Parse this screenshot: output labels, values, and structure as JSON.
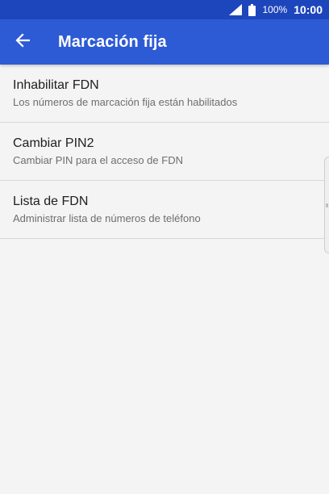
{
  "status_bar": {
    "battery_percent": "100%",
    "time": "10:00",
    "signal_icon": "signal-icon",
    "battery_icon": "battery-icon"
  },
  "app_bar": {
    "back_icon": "arrow-back-icon",
    "title": "Marcación fija"
  },
  "items": [
    {
      "title": "Inhabilitar FDN",
      "subtitle": "Los números de marcación fija están habilitados"
    },
    {
      "title": "Cambiar PIN2",
      "subtitle": "Cambiar PIN para el acceso de FDN"
    },
    {
      "title": "Lista de FDN",
      "subtitle": "Administrar lista de números de teléfono"
    }
  ],
  "colors": {
    "status_bar": "#1e46bc",
    "app_bar": "#2d5bd5",
    "background": "#f4f4f4"
  }
}
